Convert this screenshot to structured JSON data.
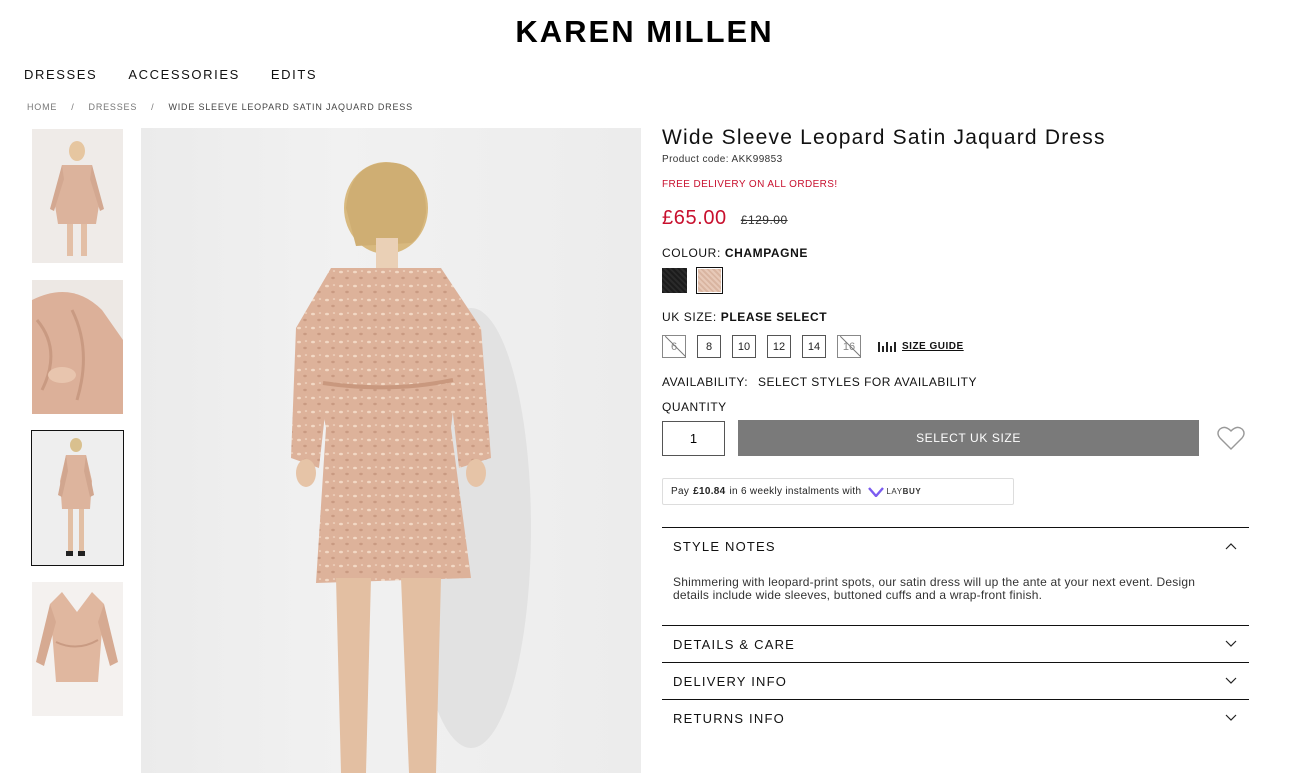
{
  "brand": "KAREN MILLEN",
  "nav": [
    "DRESSES",
    "ACCESSORIES",
    "EDITS"
  ],
  "breadcrumb": {
    "home": "HOME",
    "sep": "/",
    "category": "DRESSES",
    "current": "WIDE SLEEVE LEOPARD SATIN JAQUARD DRESS"
  },
  "product": {
    "title": "Wide Sleeve Leopard Satin Jaquard Dress",
    "code": "Product code: AKK99853",
    "free_delivery": "FREE DELIVERY ON ALL ORDERS!",
    "price": "£65.00",
    "was_price": "£129.00",
    "colour_label": "COLOUR:",
    "colour_value": "CHAMPAGNE",
    "size_label": "UK SIZE:",
    "size_value": "PLEASE SELECT",
    "sizes": [
      "6",
      "8",
      "10",
      "12",
      "14",
      "16"
    ],
    "size_guide": "SIZE GUIDE",
    "availability_label": "AVAILABILITY:",
    "availability_value": "SELECT STYLES FOR AVAILABILITY",
    "quantity_label": "QUANTITY",
    "quantity_value": "1",
    "add_button": "SELECT UK SIZE"
  },
  "laybuy": {
    "pre": "Pay",
    "amount": "£10.84",
    "post": "in 6 weekly instalments with",
    "brand_a": "LAY",
    "brand_b": "BUY"
  },
  "accordion": {
    "style_notes": {
      "title": "STYLE NOTES",
      "body": "Shimmering with leopard-print spots, our satin dress will up the ante at your next event. Design details include wide sleeves, buttoned cuffs and a wrap-front finish."
    },
    "details": "DETAILS & CARE",
    "delivery": "DELIVERY INFO",
    "returns": "RETURNS INFO"
  },
  "colors": {
    "sale_red": "#c8102e",
    "button_grey": "#7a7a7a",
    "dress_champagne": "#e2b9a1"
  }
}
